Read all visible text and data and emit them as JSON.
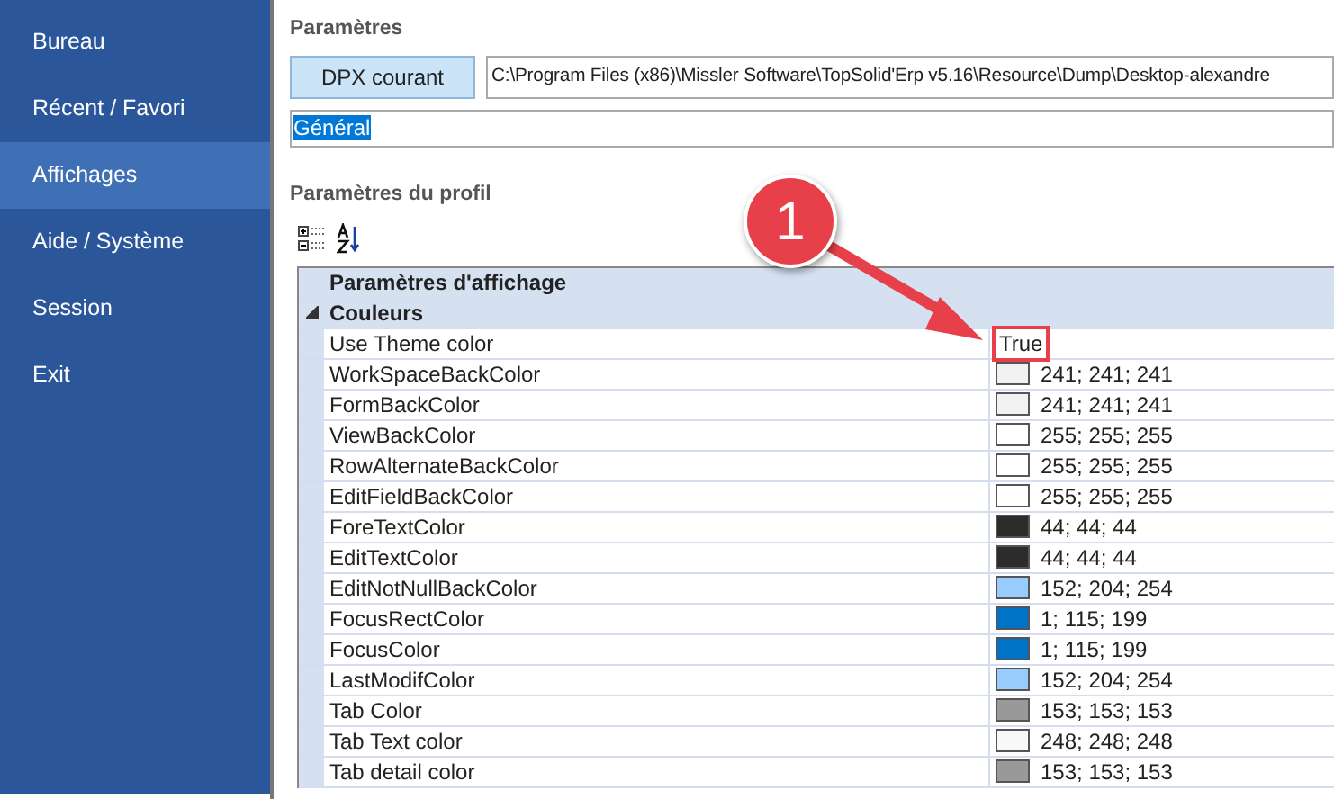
{
  "sidebar": {
    "items": [
      {
        "label": "Bureau",
        "selected": false
      },
      {
        "label": "Récent / Favori",
        "selected": false
      },
      {
        "label": "Affichages",
        "selected": true
      },
      {
        "label": "Aide / Système",
        "selected": false
      },
      {
        "label": "Session",
        "selected": false
      },
      {
        "label": "Exit",
        "selected": false
      }
    ]
  },
  "parameters": {
    "title": "Paramètres",
    "dpx_button": "DPX courant",
    "path": "C:\\Program Files (x86)\\Missler Software\\TopSolid'Erp v5.16\\Resource\\Dump\\Desktop-alexandre",
    "profile": {
      "value": "Général",
      "highlighted": true
    }
  },
  "profile_settings": {
    "title": "Paramètres du profil",
    "grid": {
      "category": "Paramètres d'affichage",
      "group": {
        "label": "Couleurs",
        "expanded": true
      },
      "rows": [
        {
          "name": "Use Theme color",
          "kind": "text",
          "value": "True",
          "annotated": true
        },
        {
          "name": "WorkSpaceBackColor",
          "kind": "color",
          "color": "#f1f1f1",
          "value": "241; 241; 241"
        },
        {
          "name": "FormBackColor",
          "kind": "color",
          "color": "#f1f1f1",
          "value": "241; 241; 241"
        },
        {
          "name": "ViewBackColor",
          "kind": "color",
          "color": "#ffffff",
          "value": "255; 255; 255"
        },
        {
          "name": "RowAlternateBackColor",
          "kind": "color",
          "color": "#ffffff",
          "value": "255; 255; 255"
        },
        {
          "name": "EditFieldBackColor",
          "kind": "color",
          "color": "#ffffff",
          "value": "255; 255; 255"
        },
        {
          "name": "ForeTextColor",
          "kind": "color",
          "color": "#2c2c2c",
          "value": "44; 44; 44"
        },
        {
          "name": "EditTextColor",
          "kind": "color",
          "color": "#2c2c2c",
          "value": "44; 44; 44"
        },
        {
          "name": "EditNotNullBackColor",
          "kind": "color",
          "color": "#98ccfe",
          "value": "152; 204; 254"
        },
        {
          "name": "FocusRectColor",
          "kind": "color",
          "color": "#0173c7",
          "value": "1; 115; 199"
        },
        {
          "name": "FocusColor",
          "kind": "color",
          "color": "#0173c7",
          "value": "1; 115; 199"
        },
        {
          "name": "LastModifColor",
          "kind": "color",
          "color": "#98ccfe",
          "value": "152; 204; 254"
        },
        {
          "name": "Tab Color",
          "kind": "color",
          "color": "#999999",
          "value": "153; 153; 153"
        },
        {
          "name": "Tab Text color",
          "kind": "color",
          "color": "#f8f8f8",
          "value": "248; 248; 248"
        },
        {
          "name": "Tab detail color",
          "kind": "color",
          "color": "#999999",
          "value": "153; 153; 153"
        }
      ]
    }
  },
  "callout": {
    "label": "1"
  }
}
